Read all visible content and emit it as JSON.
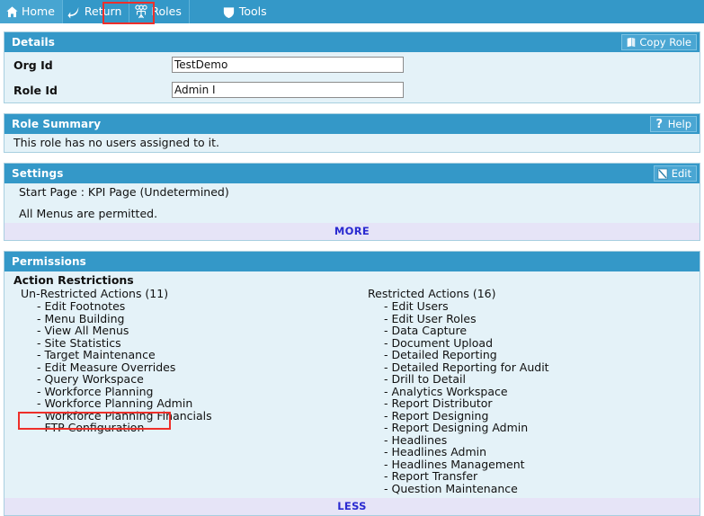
{
  "nav": {
    "tabs": [
      {
        "label": "Home",
        "icon": "home-icon",
        "active": true
      },
      {
        "label": "Return",
        "icon": "return-arrow-icon",
        "active": false
      },
      {
        "label": "Roles",
        "icon": "people-group-icon",
        "active": false,
        "highlighted": true
      },
      {
        "label": "Tools",
        "icon": "shield-icon",
        "active": false
      }
    ]
  },
  "details": {
    "title": "Details",
    "copy_button": {
      "label": "Copy Role",
      "icon": "copy-book-icon"
    },
    "fields": [
      {
        "label": "Org Id",
        "value": "TestDemo"
      },
      {
        "label": "Role Id",
        "value": "Admin I"
      }
    ]
  },
  "role_summary": {
    "title": "Role Summary",
    "help_button": {
      "label": "Help",
      "icon": "question-mark-icon"
    },
    "text": "This role has no users assigned to it."
  },
  "settings": {
    "title": "Settings",
    "edit_button": {
      "label": "Edit",
      "icon": "pencil-page-icon"
    },
    "start_page": "Start Page : KPI Page (Undetermined)",
    "menus": "All Menus are permitted.",
    "more_label": "MORE"
  },
  "permissions": {
    "title": "Permissions",
    "section_label": "Action Restrictions",
    "unrestricted": {
      "heading": "Un-Restricted Actions (11)",
      "count": 11,
      "items": [
        "- Edit Footnotes",
        "- Menu Building",
        "- View All Menus",
        "- Site Statistics",
        "- Target Maintenance",
        "- Edit Measure Overrides",
        "- Query Workspace",
        "- Workforce Planning",
        "- Workforce Planning Admin",
        "- Workforce Planning Financials",
        "- FTP Configuration"
      ]
    },
    "restricted": {
      "heading": "Restricted Actions (16)",
      "count": 16,
      "items": [
        "- Edit Users",
        "- Edit User Roles",
        "- Data Capture",
        "- Document Upload",
        "- Detailed Reporting",
        "- Detailed Reporting for Audit",
        "- Drill to Detail",
        "- Analytics Workspace",
        "- Report Distributor",
        "- Report Designing",
        "- Report Designing Admin",
        "- Headlines",
        "- Headlines Admin",
        "- Headlines Management",
        "- Report Transfer",
        "- Question Maintenance"
      ]
    },
    "less_label": "LESS"
  },
  "colors": {
    "header_blue": "#3498c8",
    "panel_bg": "#e4f2f8",
    "highlight_red": "#ee2f2a",
    "more_bar_bg": "#e6e4f7",
    "link_blue": "#2a2ad0"
  }
}
